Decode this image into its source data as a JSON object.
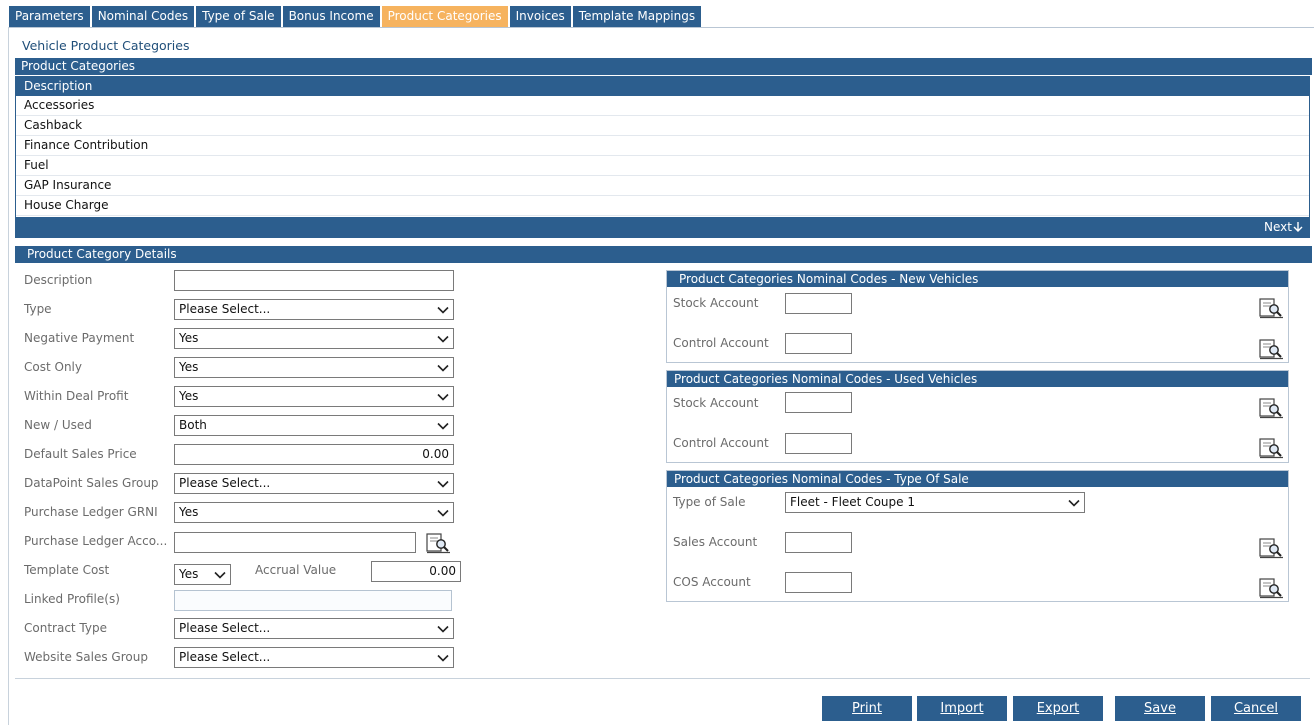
{
  "tabs": [
    {
      "label": "Parameters"
    },
    {
      "label": "Nominal Codes"
    },
    {
      "label": "Type of Sale"
    },
    {
      "label": "Bonus Income"
    },
    {
      "label": "Product Categories",
      "active": true
    },
    {
      "label": "Invoices"
    },
    {
      "label": "Template Mappings"
    }
  ],
  "page_title": "Vehicle Product Categories",
  "list_section_title": "Product Categories",
  "grid": {
    "header": "Description",
    "rows": [
      "Accessories",
      "Cashback",
      "Finance Contribution",
      "Fuel",
      "GAP Insurance",
      "House Charge"
    ],
    "next_label": "Next"
  },
  "details_title": "Product Category Details",
  "form": {
    "description": {
      "label": "Description",
      "value": ""
    },
    "type": {
      "label": "Type",
      "value": "Please Select..."
    },
    "negative_payment": {
      "label": "Negative Payment",
      "value": "Yes"
    },
    "cost_only": {
      "label": "Cost Only",
      "value": "Yes"
    },
    "within_deal_profit": {
      "label": "Within Deal Profit",
      "value": "Yes"
    },
    "new_used": {
      "label": "New / Used",
      "value": "Both"
    },
    "default_sales_price": {
      "label": "Default Sales Price",
      "value": "0.00"
    },
    "datapoint_sales_group": {
      "label": "DataPoint Sales Group",
      "value": "Please Select..."
    },
    "purchase_ledger_grni": {
      "label": "Purchase Ledger GRNI",
      "value": "Yes"
    },
    "purchase_ledger_account": {
      "label": "Purchase Ledger Acco...",
      "value": ""
    },
    "template_cost": {
      "label": "Template Cost",
      "value": "Yes"
    },
    "accrual_value": {
      "label": "Accrual Value",
      "value": "0.00"
    },
    "linked_profiles": {
      "label": "Linked Profile(s)",
      "value": ""
    },
    "contract_type": {
      "label": "Contract Type",
      "value": "Please Select..."
    },
    "website_sales_group": {
      "label": "Website Sales Group",
      "value": "Please Select..."
    }
  },
  "panels": {
    "new_vehicles": {
      "title": "Product Categories Nominal Codes - New Vehicles",
      "stock_label": "Stock Account",
      "control_label": "Control Account"
    },
    "used_vehicles": {
      "title": "Product Categories Nominal Codes - Used Vehicles",
      "stock_label": "Stock Account",
      "control_label": "Control Account"
    },
    "type_of_sale": {
      "title": "Product Categories Nominal Codes - Type Of Sale",
      "type_label": "Type of Sale",
      "type_value": "Fleet - Fleet Coupe 1",
      "sales_label": "Sales Account",
      "cos_label": "COS Account"
    }
  },
  "buttons": {
    "print": "Print",
    "import": "Import",
    "export": "Export",
    "save": "Save",
    "cancel": "Cancel"
  },
  "colors": {
    "header_blue": "#2c5e8e",
    "active_tab": "#f6b35f"
  }
}
